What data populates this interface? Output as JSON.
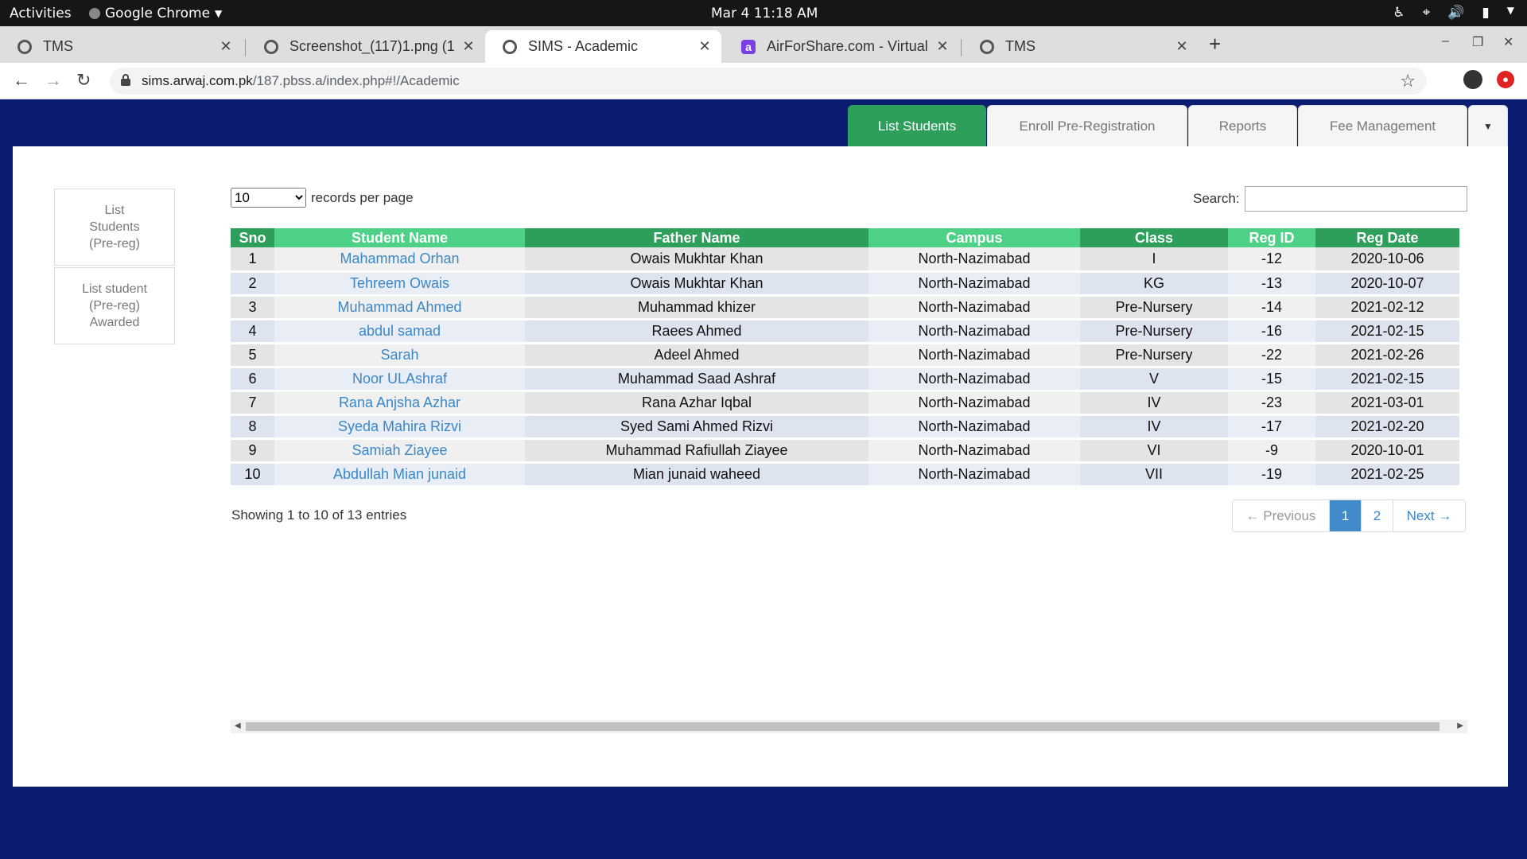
{
  "system": {
    "activities": "Activities",
    "app_name": "Google Chrome",
    "clock": "Mar 4  11:18 AM"
  },
  "browser": {
    "tabs": [
      {
        "title": "TMS"
      },
      {
        "title": "Screenshot_(117)1.png (1"
      },
      {
        "title": "SIMS - Academic"
      },
      {
        "title": "AirForShare.com - Virtual"
      },
      {
        "title": "TMS"
      }
    ],
    "url_host": "sims.arwaj.com.pk",
    "url_path": "/187.pbss.a/index.php#!/Academic"
  },
  "nav": {
    "tabs": [
      "List Students",
      "Enroll Pre-Registration",
      "Reports",
      "Fee Management"
    ],
    "active": "List Students"
  },
  "sidebar": {
    "items": [
      {
        "line1": "List",
        "line2": "Students",
        "line3": "(Pre-reg)"
      },
      {
        "line1": "List student",
        "line2": "(Pre-reg)",
        "line3": "Awarded"
      }
    ]
  },
  "table_controls": {
    "page_length": "10",
    "page_length_label": "records per page",
    "search_label": "Search:",
    "search_value": ""
  },
  "table": {
    "columns": [
      "Sno",
      "Student Name",
      "Father Name",
      "Campus",
      "Class",
      "Reg ID",
      "Reg Date"
    ],
    "rows": [
      [
        "1",
        "Mahammad Orhan",
        "Owais Mukhtar Khan",
        "North-Nazimabad",
        "I",
        "-12",
        "2020-10-06"
      ],
      [
        "2",
        "Tehreem Owais",
        "Owais Mukhtar Khan",
        "North-Nazimabad",
        "KG",
        "-13",
        "2020-10-07"
      ],
      [
        "3",
        "Muhammad Ahmed",
        "Muhammad khizer",
        "North-Nazimabad",
        "Pre-Nursery",
        "-14",
        "2021-02-12"
      ],
      [
        "4",
        "abdul samad",
        "Raees Ahmed",
        "North-Nazimabad",
        "Pre-Nursery",
        "-16",
        "2021-02-15"
      ],
      [
        "5",
        "Sarah",
        "Adeel Ahmed",
        "North-Nazimabad",
        "Pre-Nursery",
        "-22",
        "2021-02-26"
      ],
      [
        "6",
        "Noor ULAshraf",
        "Muhammad Saad Ashraf",
        "North-Nazimabad",
        "V",
        "-15",
        "2021-02-15"
      ],
      [
        "7",
        "Rana Anjsha Azhar",
        "Rana Azhar Iqbal",
        "North-Nazimabad",
        "IV",
        "-23",
        "2021-03-01"
      ],
      [
        "8",
        "Syeda Mahira Rizvi",
        "Syed Sami Ahmed Rizvi",
        "North-Nazimabad",
        "IV",
        "-17",
        "2021-02-20"
      ],
      [
        "9",
        "Samiah Ziayee",
        "Muhammad Rafiullah Ziayee",
        "North-Nazimabad",
        "VI",
        "-9",
        "2020-10-01"
      ],
      [
        "10",
        "Abdullah Mian junaid",
        "Mian junaid waheed",
        "North-Nazimabad",
        "VII",
        "-19",
        "2021-02-25"
      ]
    ]
  },
  "footer": {
    "info": "Showing 1 to 10 of 13 entries",
    "pagination": {
      "previous": "← Previous",
      "pages": [
        "1",
        "2"
      ],
      "current": "1",
      "next": "Next →"
    }
  },
  "colors": {
    "app_background": "#0c1c70",
    "header_dark_green": "#2e9e5b",
    "header_light_green": "#4cd186",
    "link_blue": "#3a87c8",
    "pager_active": "#428bca"
  }
}
